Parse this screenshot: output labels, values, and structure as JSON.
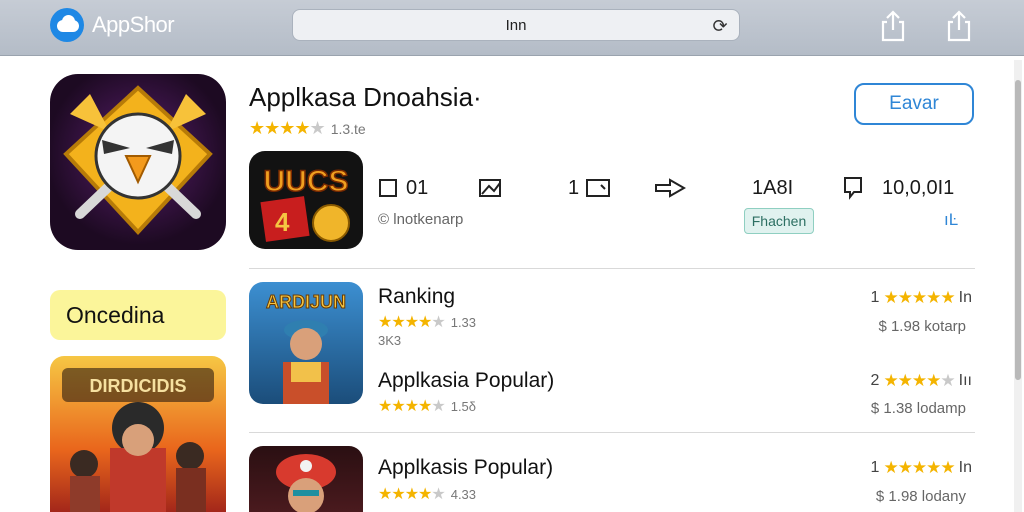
{
  "topbar": {
    "brand": "AppShor",
    "url": "Inn",
    "icons": [
      "cloud-logo-icon",
      "reload-icon",
      "share-icon",
      "share-icon"
    ]
  },
  "hero": {
    "title": "Applkasa Dnoahsia·",
    "rating_text": "1.3.te",
    "stars": 4,
    "cta_label": "Eavar",
    "stats": [
      "01",
      "",
      "1",
      "",
      "1A8I",
      "10,0,0I1"
    ],
    "subtitle": "lnotkenarp",
    "badge": "Fhachen",
    "info": "ıĿ"
  },
  "promo": {
    "label": "Oncedina",
    "banner_text": "DIRDICIDIS"
  },
  "sub_icon_text": "UUCS",
  "list": {
    "items": [
      {
        "icon_text": "ARDIJUN",
        "title": "Ranking",
        "rating_text": "1.33",
        "stars": 4,
        "extra": "3K3",
        "rank": "1",
        "rank_stars": 5,
        "rank_suffix": "In",
        "price": "$ 1.98 kotarp"
      },
      {
        "icon_text": "",
        "title": "Applkasia Popular)",
        "rating_text": "1.5δ",
        "stars": 4,
        "extra": "",
        "rank": "2",
        "rank_stars": 4,
        "rank_suffix": "Iıı",
        "price": "$ 1.38 lodamp"
      },
      {
        "icon_text": "",
        "title": "Applkasis Popular)",
        "rating_text": "4.33",
        "stars": 4,
        "extra": "",
        "rank": "1",
        "rank_stars": 5,
        "rank_suffix": "In",
        "price": "$ 1.98 lodany"
      }
    ]
  },
  "colors": {
    "accent": "#2f86d6",
    "star": "#f4b400",
    "promo_bg": "#fbf59a",
    "badge_bg": "#e0f2ef"
  }
}
